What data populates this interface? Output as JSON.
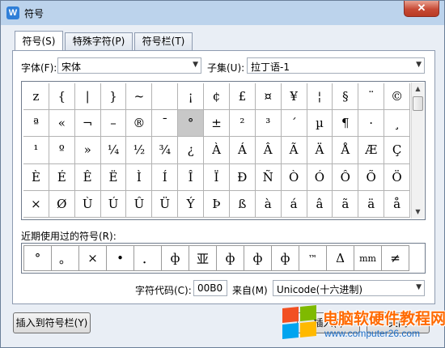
{
  "window": {
    "title": "符号",
    "app_icon": "W",
    "close_label": "✕"
  },
  "tabs": [
    "符号(S)",
    "特殊字符(P)",
    "符号栏(T)"
  ],
  "font": {
    "label": "字体(F):",
    "value": "宋体"
  },
  "subset": {
    "label": "子集(U):",
    "value": "拉丁语-1"
  },
  "symbols": [
    [
      "z",
      "{",
      "|",
      "}",
      "~",
      "",
      "¡",
      "¢",
      "£",
      "¤",
      "¥",
      "¦",
      "§",
      "¨",
      "©"
    ],
    [
      "ª",
      "«",
      "¬",
      "–",
      "®",
      "¯",
      "°",
      "±",
      "²",
      "³",
      "´",
      "µ",
      "¶",
      "·",
      "¸"
    ],
    [
      "¹",
      "º",
      "»",
      "¼",
      "½",
      "¾",
      "¿",
      "À",
      "Á",
      "Â",
      "Ã",
      "Ä",
      "Å",
      "Æ",
      "Ç"
    ],
    [
      "È",
      "É",
      "Ê",
      "Ë",
      "Ì",
      "Í",
      "Î",
      "Ï",
      "Ð",
      "Ñ",
      "Ò",
      "Ó",
      "Ô",
      "Õ",
      "Ö"
    ],
    [
      "×",
      "Ø",
      "Ù",
      "Ú",
      "Û",
      "Ü",
      "Ý",
      "Þ",
      "ß",
      "à",
      "á",
      "â",
      "ã",
      "ä",
      "å"
    ]
  ],
  "selected_symbol": "°",
  "recent": {
    "label": "近期使用过的符号(R):",
    "items": [
      "°",
      "。",
      "×",
      "•",
      "．",
      "ф",
      "亚",
      "ф",
      "ф",
      "ф",
      "™",
      "Δ",
      "mm",
      "≠",
      "¥"
    ]
  },
  "char_code": {
    "label": "字符代码(C):",
    "value": "00B0"
  },
  "from": {
    "label": "来自(M)",
    "value": "Unicode(十六进制)"
  },
  "buttons": {
    "insert_to_bar": "插入到符号栏(Y)",
    "insert": "插入(I)",
    "close": "关闭"
  },
  "watermark": {
    "text": "电脑软硬件教程网",
    "url": "www.computer26.com"
  },
  "colors": {
    "title_bar": "#bcd3ec",
    "selection": "#c8c8c8",
    "watermark_text": "#ff6a00",
    "watermark_url": "#1d6ec7"
  }
}
